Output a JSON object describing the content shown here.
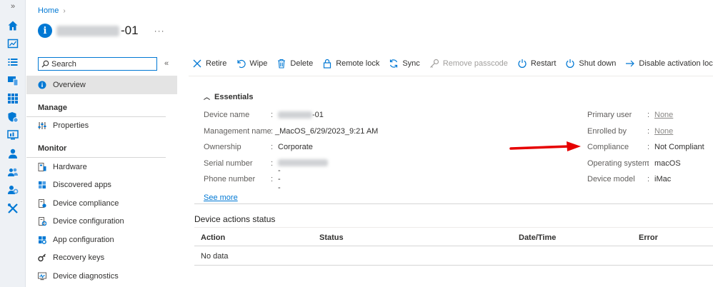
{
  "rail": {
    "expand": "»",
    "icons": [
      "home-icon",
      "dashboard-icon",
      "list-icon",
      "devices-icon",
      "apps-icon",
      "endpoint-security-icon",
      "reports-icon",
      "users-icon",
      "groups-icon",
      "tenant-admin-icon",
      "troubleshooting-icon"
    ]
  },
  "breadcrumb": {
    "home": "Home",
    "separator": "›"
  },
  "title": {
    "suffix": "-01",
    "more": "···"
  },
  "search": {
    "placeholder": "Search",
    "collapse": "«"
  },
  "menu": {
    "overview": "Overview",
    "manage_header": "Manage",
    "properties": "Properties",
    "monitor_header": "Monitor",
    "hardware": "Hardware",
    "discovered_apps": "Discovered apps",
    "device_compliance": "Device compliance",
    "device_configuration": "Device configuration",
    "app_configuration": "App configuration",
    "recovery_keys": "Recovery keys",
    "device_diagnostics": "Device diagnostics"
  },
  "toolbar": {
    "retire": "Retire",
    "wipe": "Wipe",
    "delete": "Delete",
    "remote_lock": "Remote lock",
    "sync": "Sync",
    "remove_passcode": "Remove passcode",
    "restart": "Restart",
    "shut_down": "Shut down",
    "disable_activation_lock": "Disable activation lock"
  },
  "essentials": {
    "header": "Essentials",
    "left": [
      {
        "label": "Device name",
        "value": "-01"
      },
      {
        "label": "Management name",
        "value": "_MacOS_6/29/2023_9:21 AM"
      },
      {
        "label": "Ownership",
        "value": "Corporate"
      },
      {
        "label": "Serial number",
        "value": ""
      },
      {
        "label": "Phone number",
        "value": "---"
      }
    ],
    "right": [
      {
        "label": "Primary user",
        "value": "None"
      },
      {
        "label": "Enrolled by",
        "value": "None"
      },
      {
        "label": "Compliance",
        "value": "Not Compliant"
      },
      {
        "label": "Operating system",
        "value": "macOS"
      },
      {
        "label": "Device model",
        "value": "iMac"
      }
    ],
    "colon": ":",
    "see_more": "See more"
  },
  "device_actions": {
    "title": "Device actions status",
    "columns": [
      "Action",
      "Status",
      "Date/Time",
      "Error"
    ],
    "empty": "No data"
  },
  "colors": {
    "accent": "#0078d4",
    "annotation_arrow": "#e60000"
  }
}
